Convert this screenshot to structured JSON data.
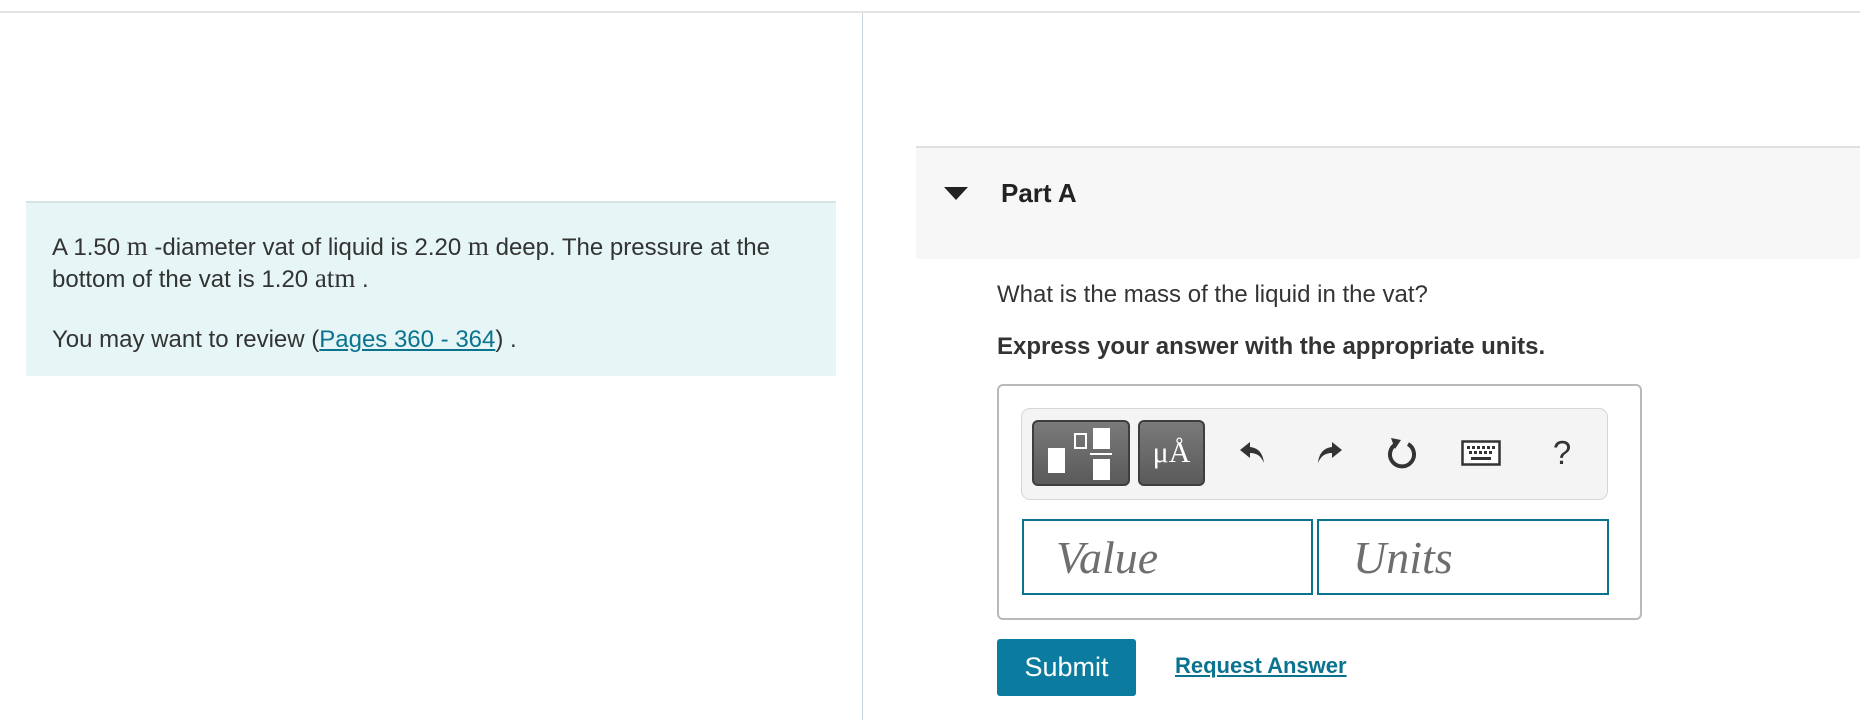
{
  "problem": {
    "line1_a": "A 1.50 ",
    "unit_m1": "m",
    "line1_b": " -diameter vat of liquid is 2.20 ",
    "unit_m2": "m",
    "line1_c": " deep. The pressure at the bottom of the vat is 1.20 ",
    "unit_atm": "atm",
    "line1_d": " .",
    "review_prefix": "You may want to review (",
    "review_link": "Pages 360 - 364",
    "review_suffix": ") ."
  },
  "part": {
    "title": "Part A",
    "question": "What is the mass of the liquid in the vat?",
    "instruction": "Express your answer with the appropriate units."
  },
  "toolbar": {
    "templates_icon": "templates-icon",
    "units_label": "μÅ",
    "undo_icon": "undo-icon",
    "redo_icon": "redo-icon",
    "reset_icon": "reset-icon",
    "keyboard_icon": "keyboard-icon",
    "help_label": "?"
  },
  "inputs": {
    "value_placeholder": "Value",
    "value": "",
    "units_placeholder": "Units",
    "units": ""
  },
  "actions": {
    "submit_label": "Submit",
    "request_answer_label": "Request Answer"
  },
  "colors": {
    "accent": "#0b7390",
    "panel_bg": "#e6f5f5"
  }
}
